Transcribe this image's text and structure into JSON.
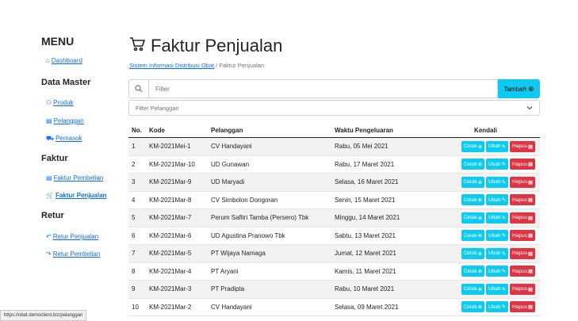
{
  "sidebar": {
    "menu_title": "MENU",
    "dashboard": "Dashboard",
    "data_master_title": "Data Master",
    "produk": "Produk",
    "pelanggan": "Pelanggan",
    "pemasok": "Pemasok",
    "faktur_title": "Faktur",
    "faktur_pembelian": "Faktur Pembelian",
    "faktur_penjualan": "Faktur Penjualan",
    "retur_title": "Retur",
    "retur_penjualan": "Retur Penjualan",
    "retur_pembelian": "Retur Pembelian"
  },
  "header": {
    "title": "Faktur Penjualan",
    "breadcrumb_home": "Sistem Informasi Distribusi Obat",
    "breadcrumb_sep": "/",
    "breadcrumb_current": "Faktur Penjualan"
  },
  "filter": {
    "placeholder": "Filter",
    "tambah_label": "Tambah",
    "select_label": "Filter Pelanggan"
  },
  "table": {
    "headers": {
      "no": "No.",
      "kode": "Kode",
      "pelanggan": "Pelanggan",
      "waktu": "Waktu Pengeluaran",
      "kendali": "Kendali"
    },
    "actions": {
      "cetak": "Cetak",
      "ubah": "Ubah",
      "hapus": "Hapus"
    },
    "rows": [
      {
        "no": "1",
        "kode": "KM-2021Mei-1",
        "pelanggan": "CV Handayani",
        "waktu": "Rabu, 05 Mei 2021"
      },
      {
        "no": "2",
        "kode": "KM-2021Mar-10",
        "pelanggan": "UD Gunawan",
        "waktu": "Rabu, 17 Maret 2021"
      },
      {
        "no": "3",
        "kode": "KM-2021Mar-9",
        "pelanggan": "UD Maryadi",
        "waktu": "Selasa, 16 Maret 2021"
      },
      {
        "no": "4",
        "kode": "KM-2021Mar-8",
        "pelanggan": "CV Simbolon Dongoran",
        "waktu": "Senin, 15 Maret 2021"
      },
      {
        "no": "5",
        "kode": "KM-2021Mar-7",
        "pelanggan": "Perum Safitri Tamba (Persero) Tbk",
        "waktu": "Minggu, 14 Maret 2021"
      },
      {
        "no": "6",
        "kode": "KM-2021Mar-6",
        "pelanggan": "UD Agustina Pranowo Tbk",
        "waktu": "Sabtu, 13 Maret 2021"
      },
      {
        "no": "7",
        "kode": "KM-2021Mar-5",
        "pelanggan": "PT Wijaya Namaga",
        "waktu": "Jumat, 12 Maret 2021"
      },
      {
        "no": "8",
        "kode": "KM-2021Mar-4",
        "pelanggan": "PT Aryani",
        "waktu": "Kamis, 11 Maret 2021"
      },
      {
        "no": "9",
        "kode": "KM-2021Mar-3",
        "pelanggan": "PT Pradipta",
        "waktu": "Rabu, 10 Maret 2021"
      },
      {
        "no": "10",
        "kode": "KM-2021Mar-2",
        "pelanggan": "CV Handayani",
        "waktu": "Selasa, 09 Maret 2021"
      }
    ]
  },
  "statusbar": {
    "url": "https://obat.democlient.biz/pelanggan"
  },
  "colors": {
    "info": "#0dcaf0",
    "danger": "#dc3545",
    "link": "#0d6efd"
  }
}
